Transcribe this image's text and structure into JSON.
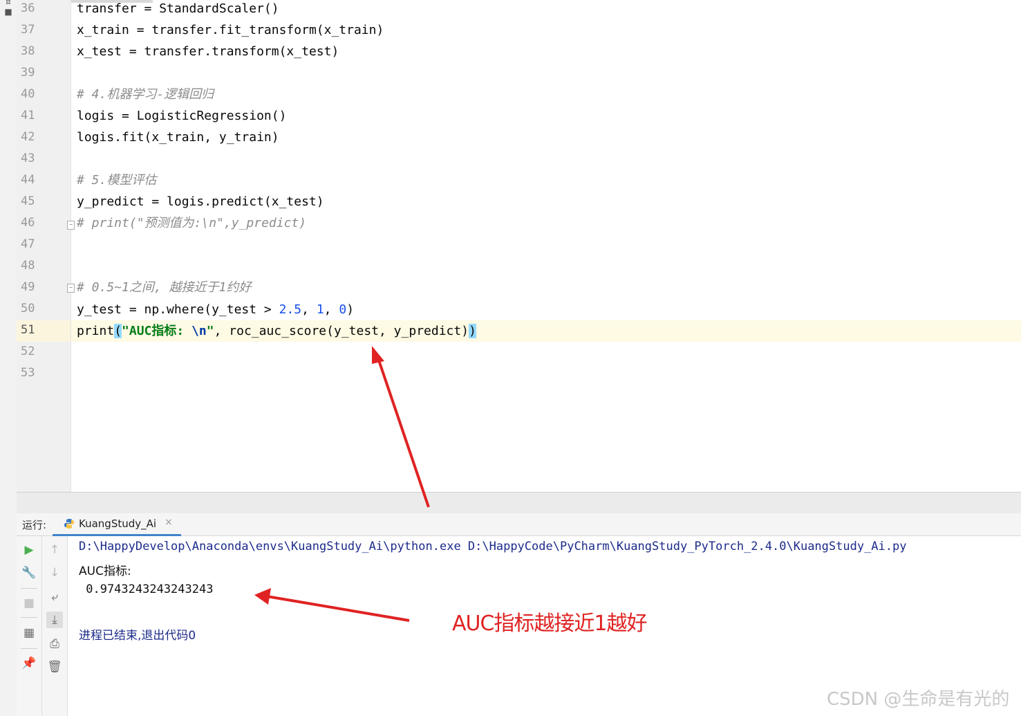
{
  "editor": {
    "lines": [
      {
        "n": "36",
        "text": "transfer = StandardScaler()"
      },
      {
        "n": "37",
        "text": "x_train = transfer.fit_transform(x_train)"
      },
      {
        "n": "38",
        "text": "x_test = transfer.transform(x_test)"
      },
      {
        "n": "39",
        "text": ""
      },
      {
        "n": "40",
        "comment": "# 4.机器学习-逻辑回归"
      },
      {
        "n": "41",
        "text": "logis = LogisticRegression()"
      },
      {
        "n": "42",
        "text": "logis.fit(x_train, y_train)"
      },
      {
        "n": "43",
        "text": ""
      },
      {
        "n": "44",
        "comment": "# 5.模型评估"
      },
      {
        "n": "45",
        "text": "y_predict = logis.predict(x_test)"
      },
      {
        "n": "46",
        "comment": "# print(\"预测值为:\\n\",y_predict)"
      },
      {
        "n": "47",
        "text": ""
      },
      {
        "n": "48",
        "text": ""
      },
      {
        "n": "49",
        "comment": "# 0.5~1之间, 越接近于1约好"
      },
      {
        "n": "50",
        "text": ""
      },
      {
        "n": "51",
        "text": ""
      },
      {
        "n": "52",
        "text": ""
      },
      {
        "n": "53",
        "text": ""
      }
    ],
    "line50": {
      "pre": "y_test = np.where(y_test > ",
      "num1": "2.5",
      "sep1": ", ",
      "num2": "1",
      "sep2": ", ",
      "num3": "0",
      "post": ")"
    },
    "line51": {
      "fn": "print",
      "open": "(",
      "str1": "\"AUC指标: ",
      "esc": "\\n",
      "str2": "\"",
      "rest": ", roc_auc_score(y_test, y_predict)",
      "close": ")"
    }
  },
  "run_panel": {
    "label": "运行:",
    "tab_name": "KuangStudy_Ai",
    "close_glyph": "×"
  },
  "console": {
    "command": "D:\\HappyDevelop\\Anaconda\\envs\\KuangStudy_Ai\\python.exe D:\\HappyCode\\PyCharm\\KuangStudy_PyTorch_2.4.0\\KuangStudy_Ai.py",
    "out1": "AUC指标:",
    "out2": " 0.9743243243243243",
    "exit": "进程已结束,退出代码0"
  },
  "annotation": "AUC指标越接近1越好",
  "watermark": "CSDN @生命是有光的",
  "icons": {
    "run": "run-icon",
    "wrench": "wrench-icon",
    "stop": "stop-icon",
    "layout": "layout-icon",
    "pin": "pin-icon",
    "up": "arrow-up-icon",
    "down": "arrow-down-icon",
    "wrap": "soft-wrap-icon",
    "scroll": "scroll-to-end-icon",
    "print": "print-icon",
    "trash": "trash-icon"
  },
  "colors": {
    "annotation_red": "#e02222",
    "accent_blue": "#4083c9"
  }
}
